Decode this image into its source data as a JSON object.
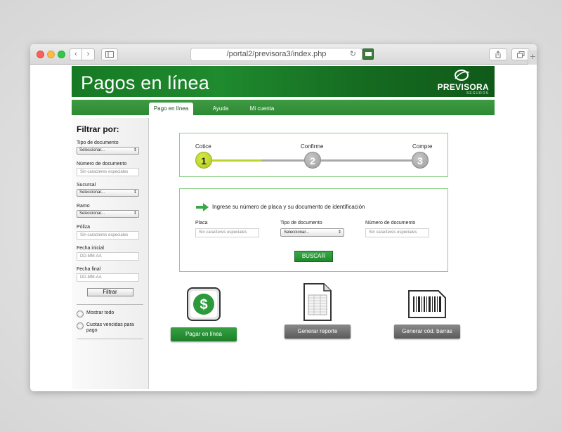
{
  "browser": {
    "url": "/portal2/previsora3/index.php",
    "back_icon": "‹",
    "forward_icon": "›",
    "reload_icon": "↻",
    "plus_icon": "+"
  },
  "header": {
    "title": "Pagos en línea",
    "logo_name": "PREVISORA",
    "logo_sub": "SEGUROS"
  },
  "menu": {
    "items": [
      {
        "label": "Pago en línea",
        "active": true
      },
      {
        "label": "Ayuda",
        "active": false
      },
      {
        "label": "Mi cuenta",
        "active": false
      }
    ]
  },
  "sidebar": {
    "title": "Filtrar por:",
    "tipo_documento": {
      "label": "Tipo de documento",
      "value": "Seleccionar..."
    },
    "numero_documento": {
      "label": "Número de documento",
      "placeholder": "Sin caracteres especiales"
    },
    "sucursal": {
      "label": "Sucursal",
      "value": "Seleccionar..."
    },
    "ramo": {
      "label": "Ramo",
      "value": "Seleccionar..."
    },
    "poliza": {
      "label": "Póliza",
      "placeholder": "Sin caracteres especiales"
    },
    "fecha_inicial": {
      "label": "Fecha inicial",
      "placeholder": "DD-MM-AA"
    },
    "fecha_final": {
      "label": "Fecha final",
      "placeholder": "DD-MM-AA"
    },
    "filter_button": "Filtrar",
    "radio_all": "Mostrar todo",
    "radio_overdue": "Cuotas vencidas para pago"
  },
  "steps": [
    {
      "label": "Cotice",
      "number": "1"
    },
    {
      "label": "Confirme",
      "number": "2"
    },
    {
      "label": "Compre",
      "number": "3"
    }
  ],
  "search": {
    "hint": "Ingrese su número de placa y su documento de identificación",
    "placa": {
      "label": "Placa",
      "placeholder": "Sin caracteres especiales"
    },
    "tipo_documento": {
      "label": "Tipo de documento",
      "value": "Seleccionar..."
    },
    "numero_documento": {
      "label": "Número de documento",
      "placeholder": "Sin caracteres especiales"
    },
    "button": "BUSCAR"
  },
  "actions": [
    {
      "label": "Pagar en línea",
      "icon": "dollar-icon"
    },
    {
      "label": "Generar reporte",
      "icon": "report-icon"
    },
    {
      "label": "Generar cód. barras",
      "icon": "barcode-icon"
    }
  ],
  "colors": {
    "brand_green": "#1f8a2e",
    "step_active": "#bcd42e",
    "step_inactive": "#a9a9a9",
    "box_border": "#8ccf83"
  }
}
